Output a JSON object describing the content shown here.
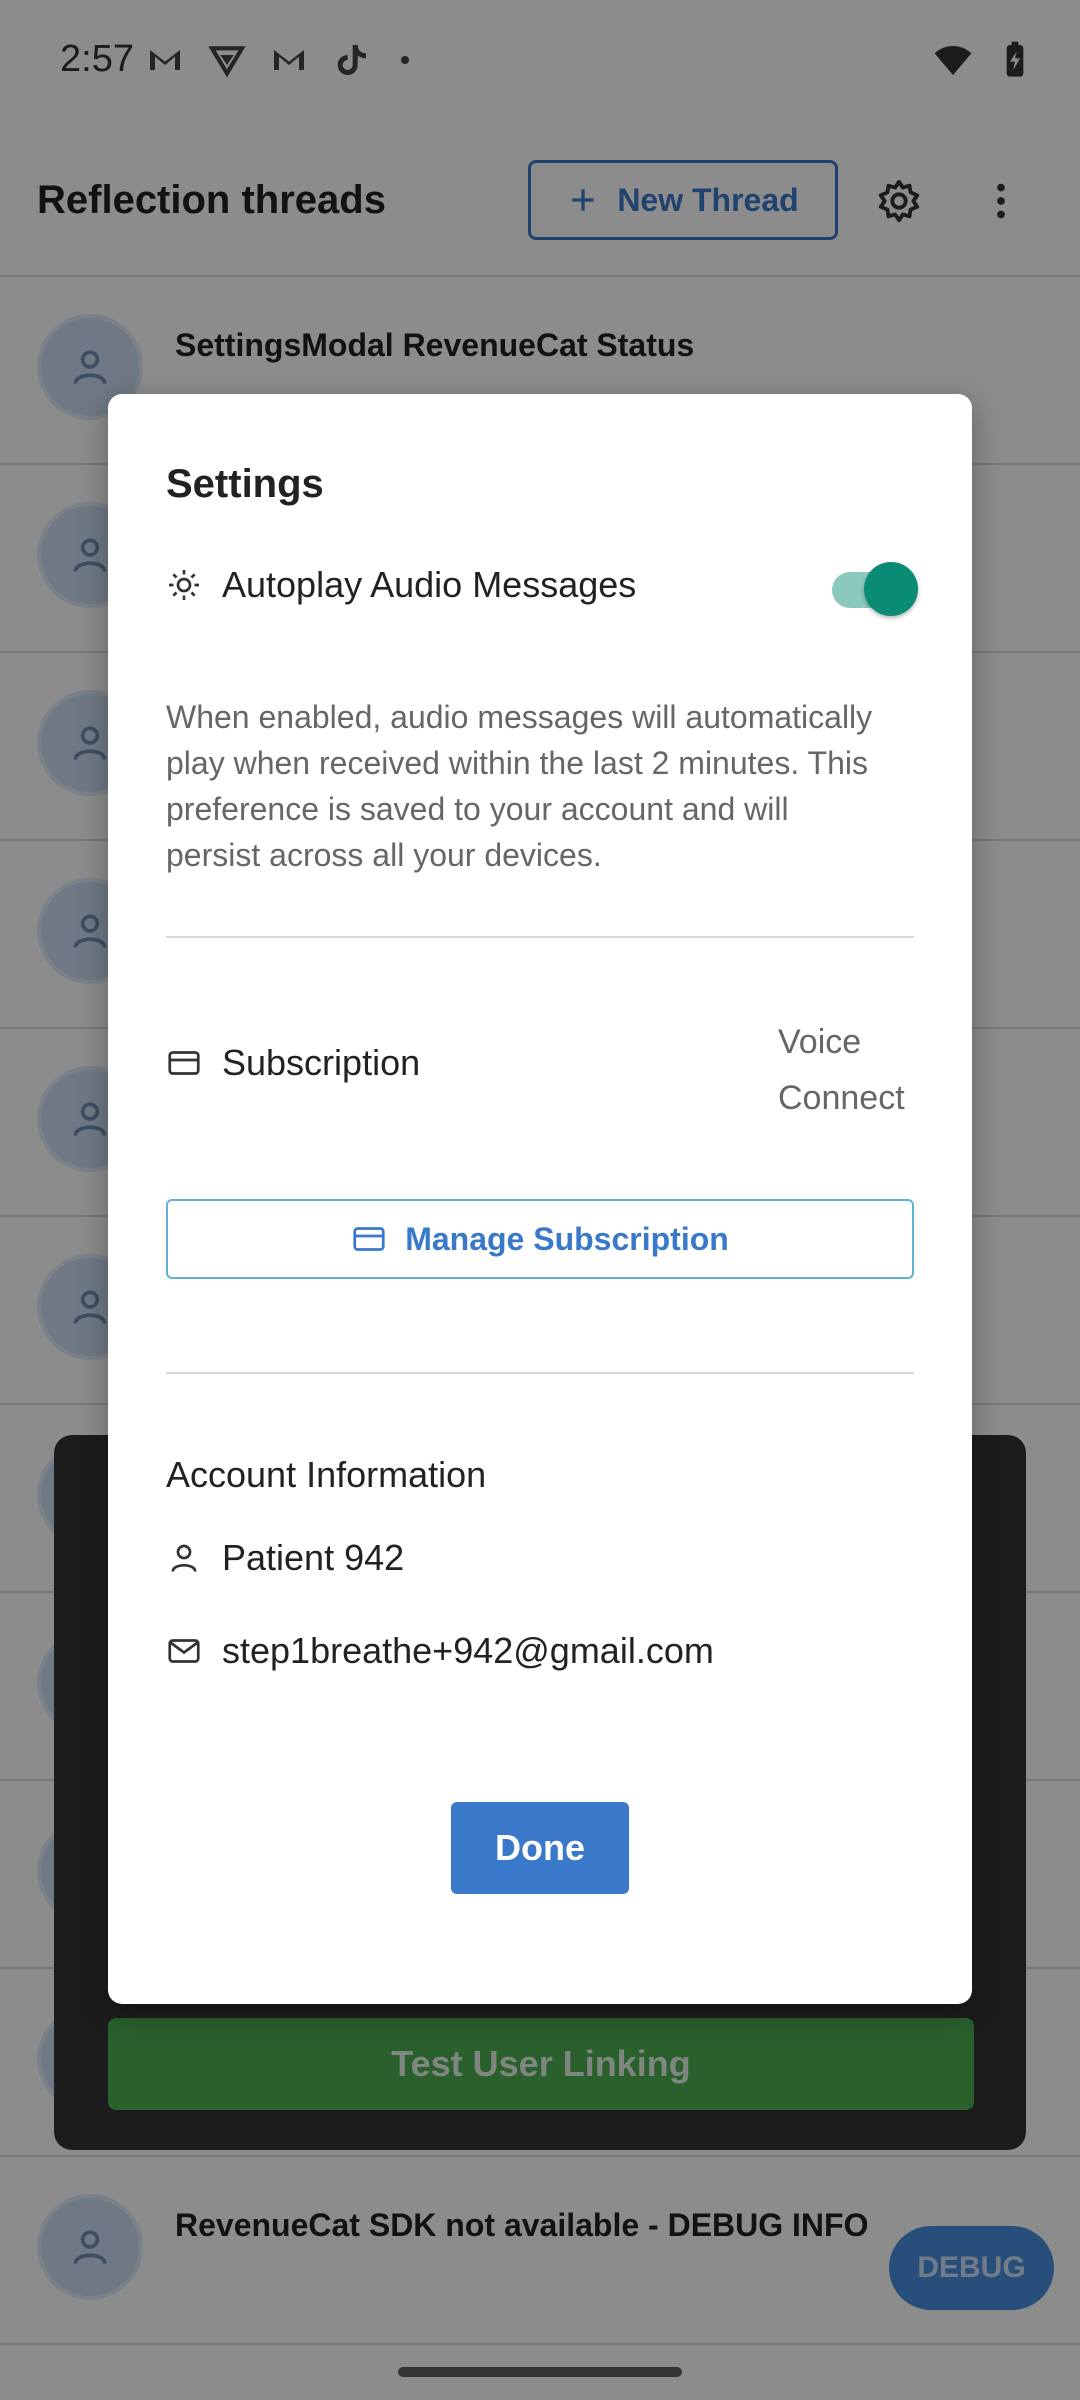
{
  "status_bar": {
    "time": "2:57"
  },
  "header": {
    "title": "Reflection threads",
    "new_thread_label": "New Thread"
  },
  "threads": [
    {
      "title": "SettingsModal RevenueCat Status"
    },
    {
      "title": ""
    },
    {
      "title": ""
    },
    {
      "title": ""
    },
    {
      "title": ""
    },
    {
      "title": ""
    },
    {
      "title": ""
    },
    {
      "title": ""
    },
    {
      "title": ""
    },
    {
      "title": ""
    },
    {
      "title": "RevenueCat SDK not available - DEBUG INFO"
    }
  ],
  "debug_panel": {
    "test_button_label": "Test User Linking"
  },
  "debug_fab_label": "DEBUG",
  "modal": {
    "title": "Settings",
    "autoplay": {
      "label": "Autoplay Audio Messages",
      "enabled": true,
      "description": "When enabled, audio messages will automatically play when received within the last 2 minutes. This preference is saved to your account and will persist across all your devices."
    },
    "subscription": {
      "label": "Subscription",
      "value": "Voice Connect",
      "manage_label": "Manage Subscription"
    },
    "account": {
      "section_title": "Account Information",
      "name": "Patient 942",
      "email": "step1breathe+942@gmail.com"
    },
    "done_label": "Done"
  },
  "colors": {
    "accent": "#3a78c9",
    "toggle_on": "#0a8c74",
    "debug_green": "#4caf50"
  }
}
